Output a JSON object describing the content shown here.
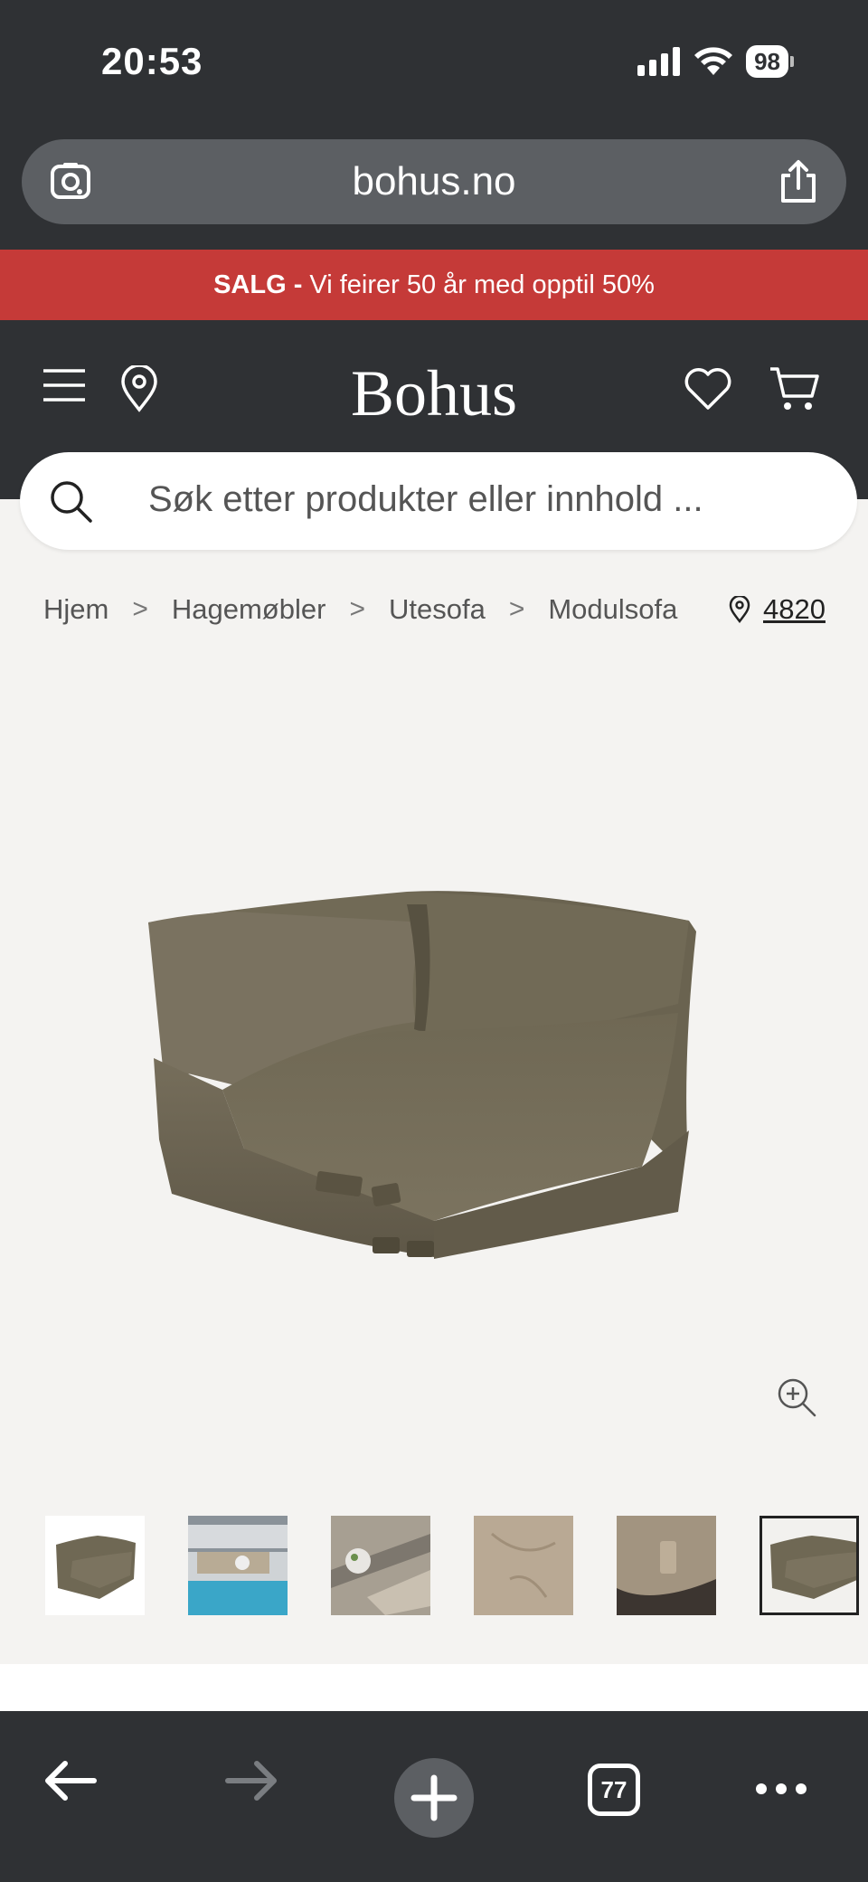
{
  "status_bar": {
    "time": "20:53",
    "battery": "98",
    "icons": [
      "cellular-signal-icon",
      "wifi-icon",
      "battery-icon"
    ]
  },
  "browser": {
    "url": "bohus.no",
    "tab_count": "77"
  },
  "sale_banner": {
    "bold": "SALG -",
    "text": " Vi feirer 50 år med opptil 50%"
  },
  "header": {
    "logo": "Bohus",
    "icons": [
      "menu-icon",
      "location-pin-icon",
      "heart-icon",
      "cart-icon"
    ]
  },
  "search": {
    "placeholder": "Søk etter produkter eller innhold ..."
  },
  "breadcrumb": {
    "items": [
      "Hjem",
      "Hagemøbler",
      "Utesofa",
      "Modulsofa"
    ],
    "separator": ">",
    "store_code": "4820"
  },
  "gallery": {
    "thumbnail_count": 6,
    "selected_index": 5
  },
  "colors": {
    "dark": "#2f3134",
    "sale_red": "#c53a38",
    "page_bg": "#f4f3f1",
    "sofa": "#6b6452"
  }
}
